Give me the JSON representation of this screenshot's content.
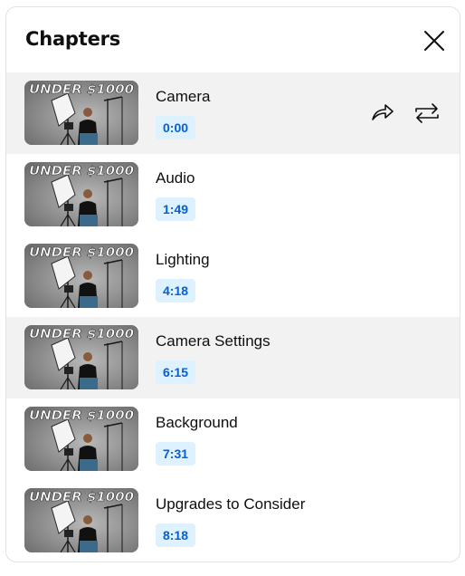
{
  "panel": {
    "title": "Chapters",
    "close_icon": "close-icon"
  },
  "thumbnail_text": "UNDER $1000",
  "chapters": [
    {
      "title": "Camera",
      "time": "0:00",
      "active": true,
      "actions": [
        "share-icon",
        "repeat-icon"
      ]
    },
    {
      "title": "Audio",
      "time": "1:49",
      "active": false
    },
    {
      "title": "Lighting",
      "time": "4:18",
      "active": false
    },
    {
      "title": "Camera Settings",
      "time": "6:15",
      "active": true
    },
    {
      "title": "Background",
      "time": "7:31",
      "active": false
    },
    {
      "title": "Upgrades to Consider",
      "time": "8:18",
      "active": false
    }
  ],
  "colors": {
    "timestamp_bg": "#def1ff",
    "timestamp_text": "#065fd4",
    "active_row_bg": "#f2f2f2"
  }
}
